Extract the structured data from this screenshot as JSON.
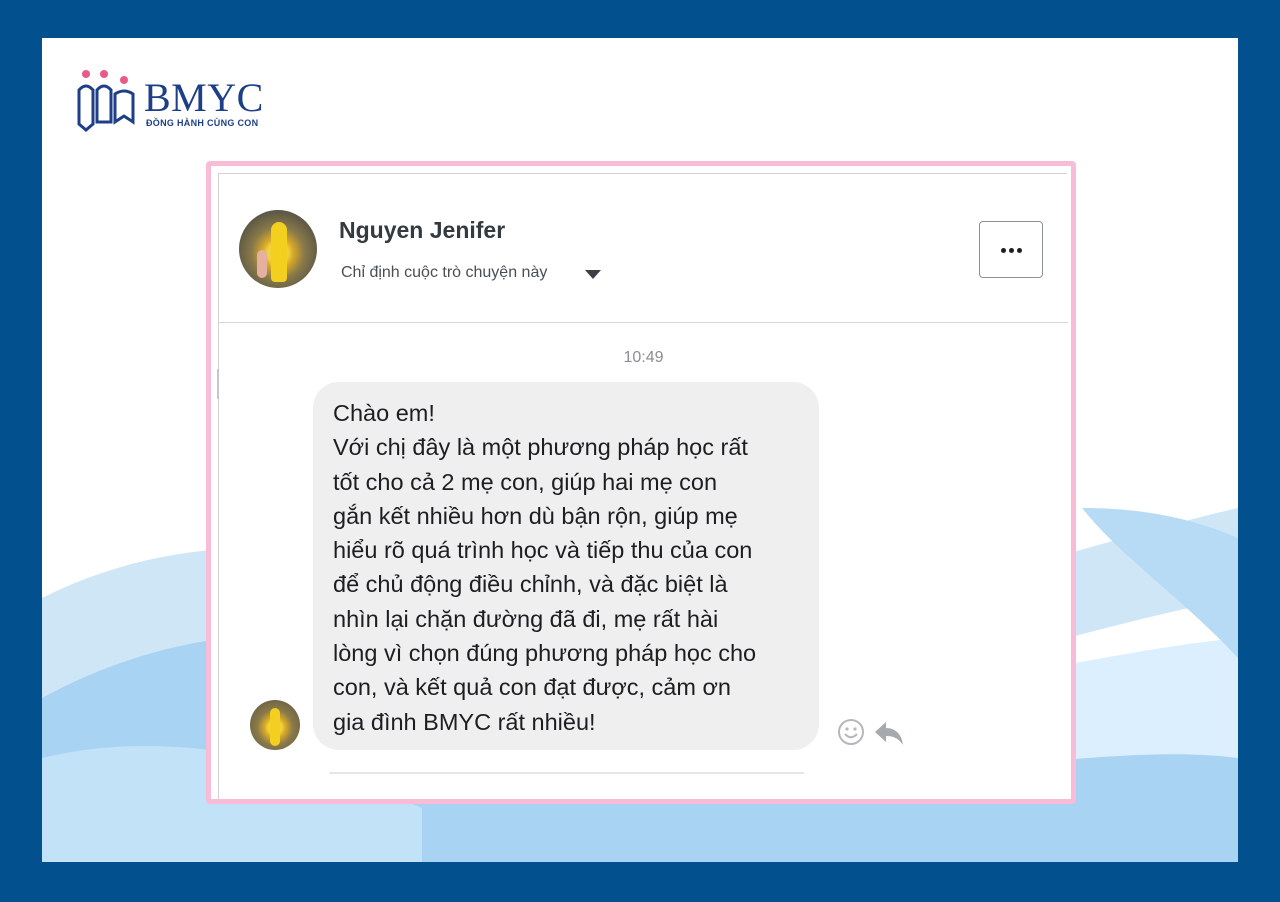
{
  "brand": {
    "name": "BMYC",
    "tagline": "ĐỒNG HÀNH CÙNG CON",
    "colors": {
      "frame": "#03508e",
      "brand_blue": "#1d3f87",
      "brand_pink": "#e95a86",
      "pink_border": "#f8bcd6"
    }
  },
  "conversation": {
    "contact_name": "Nguyen Jenifer",
    "assign_label": "Chỉ định cuộc trò chuyện này",
    "assign_icon": "caret-down-icon",
    "more_icon": "more-options-icon",
    "timestamp": "10:49",
    "message_lines": [
      "Chào em!",
      "Với chị đây là một phương pháp học rất",
      "tốt cho cả 2 mẹ con, giúp hai mẹ con",
      "gắn kết nhiều hơn dù bận rộn, giúp mẹ",
      "hiểu rõ quá trình học và tiếp thu của con",
      "để chủ động điều chỉnh, và đặc biệt là",
      "nhìn lại chặn đường đã đi, mẹ rất hài",
      "lòng vì chọn đúng phương pháp học cho",
      "con,  và kết quả con đạt được, cảm ơn",
      "gia đình BMYC rất nhiều!"
    ],
    "message_actions": [
      "smiley-react-icon",
      "reply-arrow-icon"
    ]
  }
}
